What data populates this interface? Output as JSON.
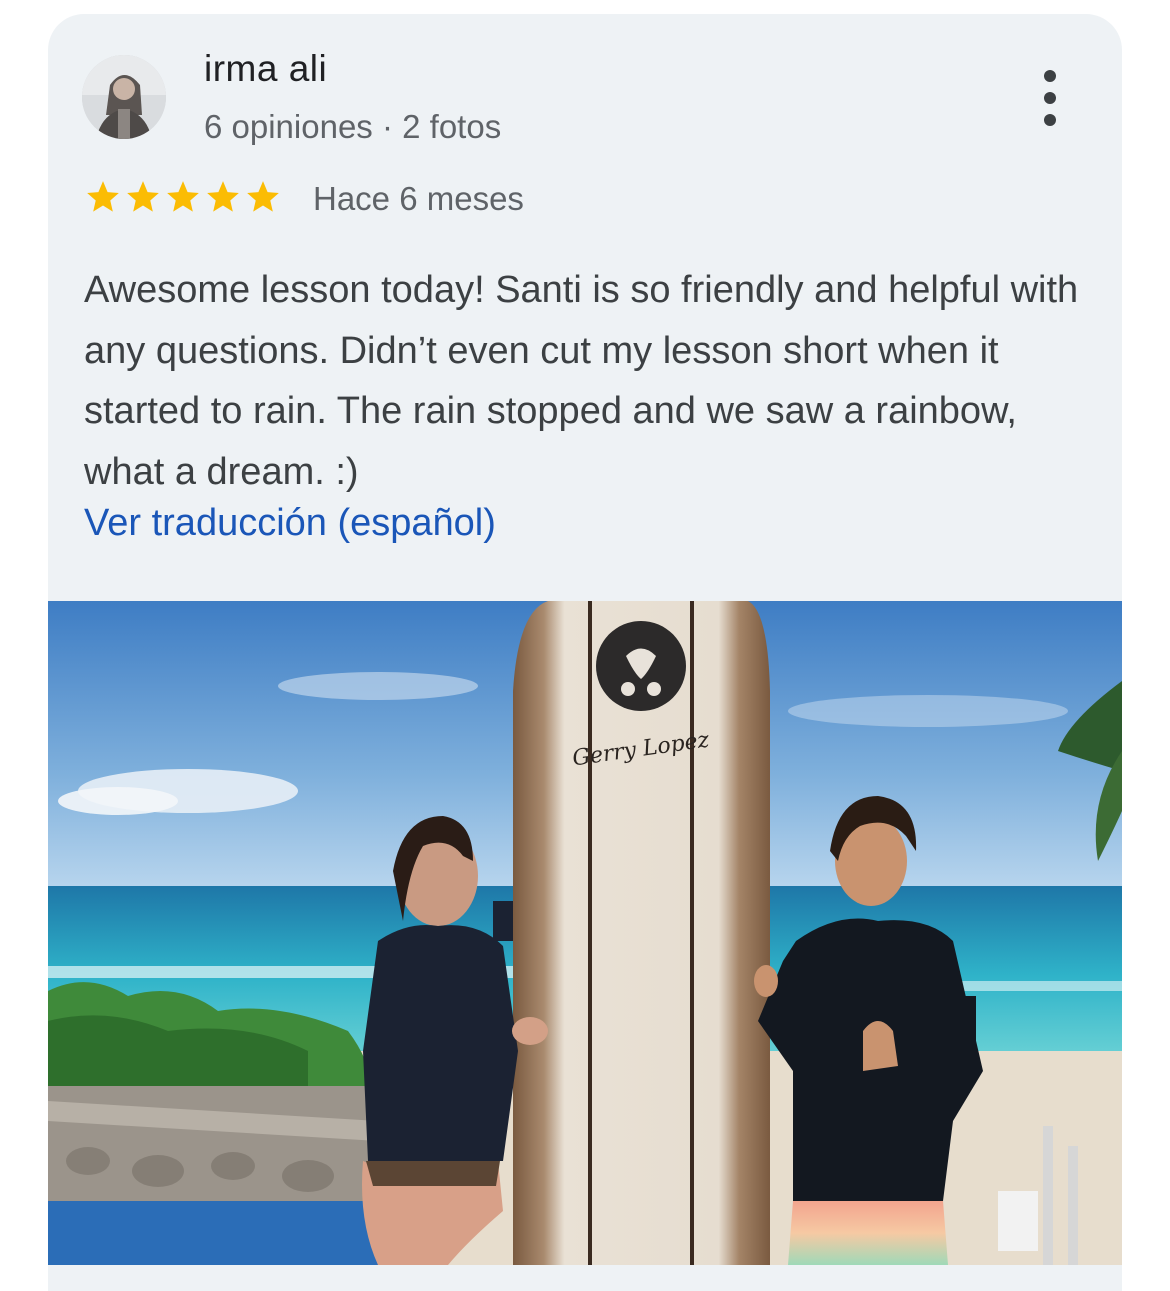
{
  "review": {
    "author": "irma ali",
    "author_meta": "6 opiniones · 2 fotos",
    "rating": 5,
    "max_rating": 5,
    "time_ago": "Hace 6 meses",
    "text": "Awesome lesson today! Santi is so friendly and helpful with any questions. Didn’t even cut my lesson short when it started to rain. The rain stopped and we saw a rainbow, what a dream. :)",
    "translate_link": "Ver traducción (español)",
    "menu_icon": "more-vert-icon",
    "star_color": "#fbbc04",
    "link_color": "#1a56b8"
  },
  "photo": {
    "board_signature": "Gerry Lopez"
  }
}
